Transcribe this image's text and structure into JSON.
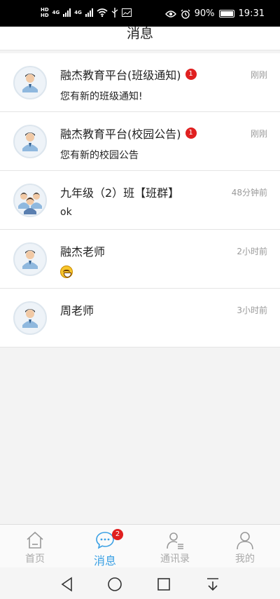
{
  "status_bar": {
    "network_hd": "HD",
    "network_4g": "4G",
    "battery": "90%",
    "time": "19:31"
  },
  "header": {
    "title": "消息"
  },
  "conversations": [
    {
      "title": "融杰教育平台(班级通知)",
      "badge": "1",
      "time": "刚刚",
      "preview": "您有新的班级通知!",
      "avatar": "teacher-avatar"
    },
    {
      "title": "融杰教育平台(校园公告)",
      "badge": "1",
      "time": "刚刚",
      "preview": "您有新的校园公告",
      "avatar": "teacher-avatar"
    },
    {
      "title": "九年级（2）班【班群】",
      "badge": "",
      "time": "48分钟前",
      "preview": "ok",
      "avatar": "group-avatar"
    },
    {
      "title": "融杰老师",
      "badge": "",
      "time": "2小时前",
      "preview": "",
      "avatar": "teacher-avatar",
      "preview_emoji": "grinning-face-emoji"
    },
    {
      "title": "周老师",
      "badge": "",
      "time": "3小时前",
      "preview": "",
      "avatar": "teacher-avatar"
    }
  ],
  "tabs": [
    {
      "label": "首页",
      "icon": "home-icon"
    },
    {
      "label": "消息",
      "icon": "chat-icon",
      "badge": "2",
      "active": true
    },
    {
      "label": "通讯录",
      "icon": "contacts-icon"
    },
    {
      "label": "我的",
      "icon": "profile-icon"
    }
  ],
  "colors": {
    "accent": "#3aa0e4",
    "badge": "#e02020"
  }
}
